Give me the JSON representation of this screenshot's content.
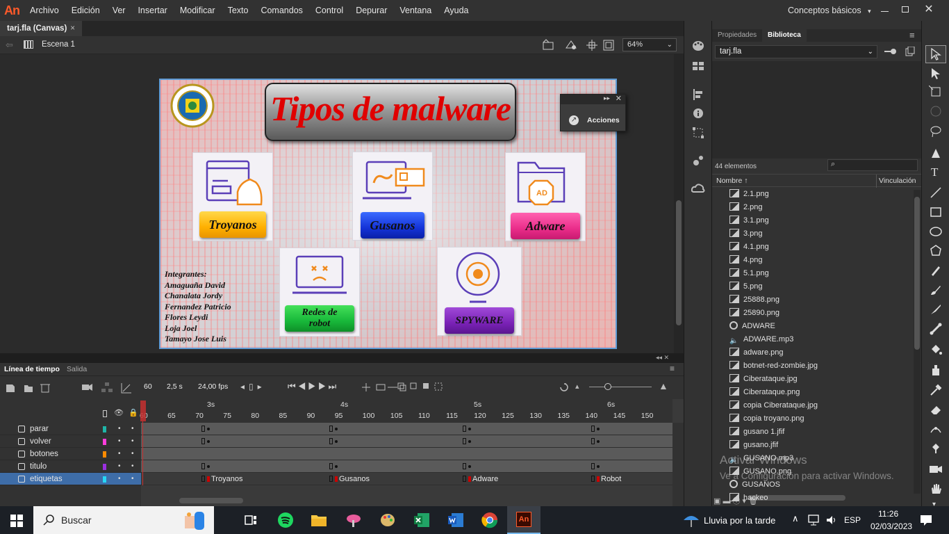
{
  "app": {
    "logo": "An",
    "workspace": "Conceptos básicos"
  },
  "menu": [
    "Archivo",
    "Edición",
    "Ver",
    "Insertar",
    "Modificar",
    "Texto",
    "Comandos",
    "Control",
    "Depurar",
    "Ventana",
    "Ayuda"
  ],
  "document": {
    "tab_label": "tarj.fla (Canvas)",
    "scene": "Escena 1",
    "zoom": "64%"
  },
  "stage": {
    "title": "Tipos de malware",
    "cards": {
      "troyanos": "Troyanos",
      "gusanos": "Gusanos",
      "adware": "Adware",
      "redes_line1": "Redes de",
      "redes_line2": "robot",
      "spyware": "SPYWARE"
    },
    "members": [
      "Integrantes:",
      "Amaguaña David",
      "Chanalata Jordy",
      "Fernandez Patricio",
      "Flores Leydi",
      "Loja Joel",
      "Tamayo Jose Luis"
    ],
    "adware_icon_text": "AD"
  },
  "actions_panel": {
    "label": "Acciones"
  },
  "right_panel": {
    "tabs": [
      "Propiedades",
      "Biblioteca"
    ],
    "library_file": "tarj.fla",
    "count": "44 elementos",
    "col_name": "Nombre ↑",
    "col_link": "Vinculación",
    "items": [
      {
        "name": "2.1.png",
        "type": "image"
      },
      {
        "name": "2.png",
        "type": "image"
      },
      {
        "name": "3.1.png",
        "type": "image"
      },
      {
        "name": "3.png",
        "type": "image"
      },
      {
        "name": "4.1.png",
        "type": "image"
      },
      {
        "name": "4.png",
        "type": "image"
      },
      {
        "name": "5.1.png",
        "type": "image"
      },
      {
        "name": "5.png",
        "type": "image"
      },
      {
        "name": "25888.png",
        "type": "image"
      },
      {
        "name": "25890.png",
        "type": "image"
      },
      {
        "name": "ADWARE",
        "type": "symbol"
      },
      {
        "name": "ADWARE.mp3",
        "type": "sound"
      },
      {
        "name": "adware.png",
        "type": "image"
      },
      {
        "name": "botnet-red-zombie.jpg",
        "type": "image"
      },
      {
        "name": "Ciberataque.jpg",
        "type": "image"
      },
      {
        "name": "Ciberataque.png",
        "type": "image"
      },
      {
        "name": "copia Ciberataque.jpg",
        "type": "image"
      },
      {
        "name": "copia troyano.png",
        "type": "image"
      },
      {
        "name": "gusano 1.jfif",
        "type": "image"
      },
      {
        "name": "gusano.jfif",
        "type": "image"
      },
      {
        "name": "GUSANO.mp3",
        "type": "sound"
      },
      {
        "name": "GUSANO.png",
        "type": "image"
      },
      {
        "name": "GUSANOS",
        "type": "symbol"
      },
      {
        "name": "hackeo",
        "type": "image"
      }
    ],
    "watermark_line1": "Activar Windows",
    "watermark_line2": "Ve a Configuración para activar Windows."
  },
  "timeline": {
    "tabs": [
      "Línea de tiempo",
      "Salida"
    ],
    "current_frame": "60",
    "time": "2,5 s",
    "fps": "24,00 fps",
    "seconds": [
      "3s",
      "4s",
      "5s",
      "6s"
    ],
    "frame_numbers": [
      "60",
      "65",
      "70",
      "75",
      "80",
      "85",
      "90",
      "95",
      "100",
      "105",
      "110",
      "115",
      "120",
      "125",
      "130",
      "135",
      "140",
      "145",
      "150"
    ],
    "layers": [
      {
        "name": "parar",
        "color": "#1fb5a8"
      },
      {
        "name": "volver",
        "color": "#ff3ddc"
      },
      {
        "name": "botones",
        "color": "#ff8a00"
      },
      {
        "name": "titulo",
        "color": "#9b2fe0"
      },
      {
        "name": "etiquetas",
        "color": "#27d6f5"
      }
    ],
    "frame_labels": [
      "Troyanos",
      "Gusanos",
      "Adware",
      "Robot"
    ]
  },
  "taskbar": {
    "search": "Buscar",
    "weather": "Lluvia por la tarde",
    "lang": "ESP",
    "time": "11:26",
    "date": "02/03/2023"
  }
}
